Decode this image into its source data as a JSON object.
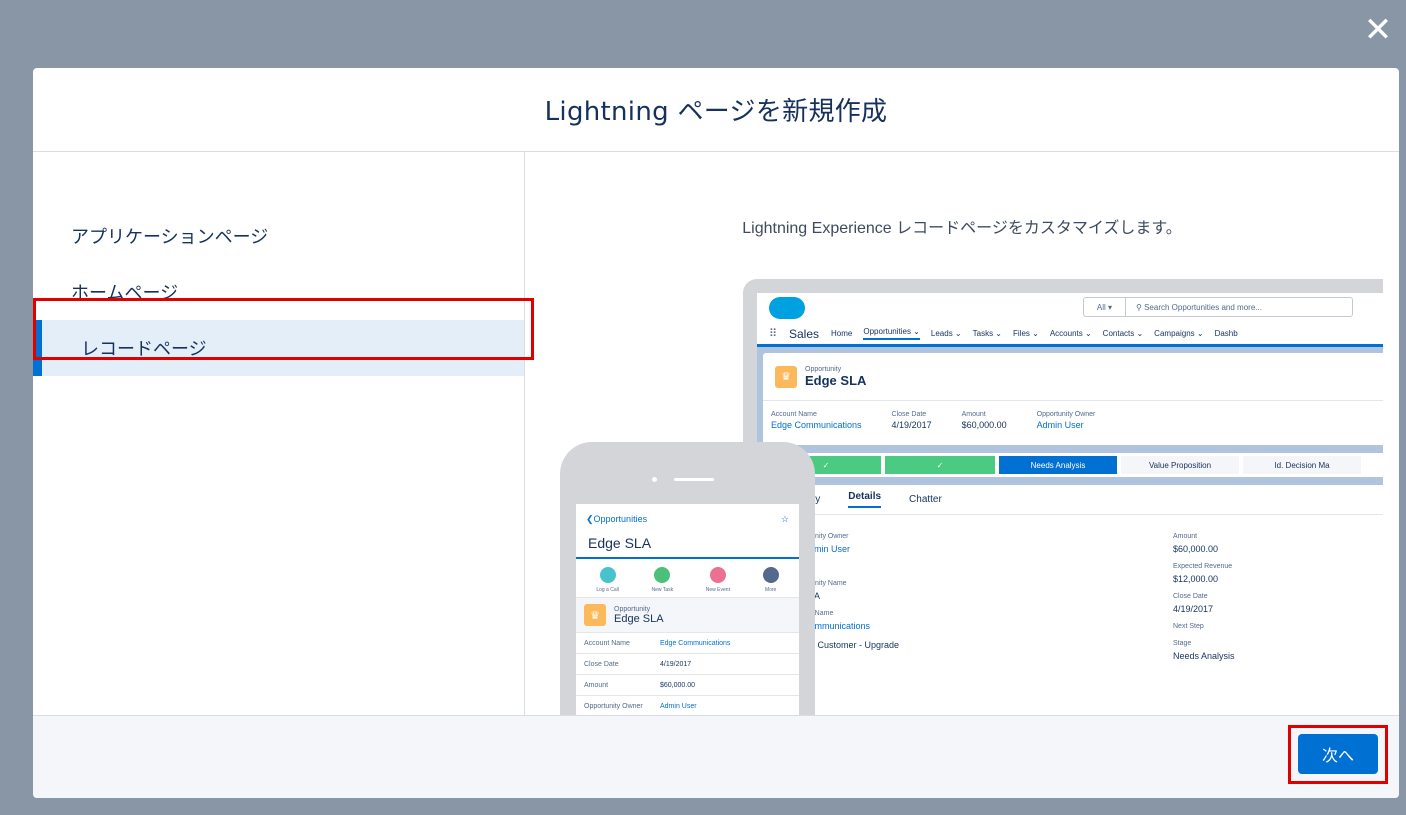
{
  "close_label": "✕",
  "modal": {
    "title": "Lightning ページを新規作成",
    "page_types": [
      {
        "label": "アプリケーションページ"
      },
      {
        "label": "ホームページ"
      },
      {
        "label": "レコードページ"
      }
    ],
    "description": "Lightning Experience レコードページをカスタマイズします。",
    "next_label": "次へ"
  },
  "desktop_preview": {
    "search_scope": "All ▾",
    "search_placeholder": "Search Opportunities and more...",
    "app_name": "Sales",
    "nav": [
      "Home",
      "Opportunities ⌄",
      "Leads ⌄",
      "Tasks ⌄",
      "Files ⌄",
      "Accounts ⌄",
      "Contacts ⌄",
      "Campaigns ⌄",
      "Dashb"
    ],
    "object_label": "Opportunity",
    "record_name": "Edge SLA",
    "fields": [
      {
        "label": "Account Name",
        "value": "Edge Communications"
      },
      {
        "label": "Close Date",
        "value": "4/19/2017"
      },
      {
        "label": "Amount",
        "value": "$60,000.00"
      },
      {
        "label": "Opportunity Owner",
        "value": "Admin User"
      }
    ],
    "path": [
      "✓",
      "✓",
      "Needs Analysis",
      "Value Proposition",
      "Id. Decision Ma"
    ],
    "tabs": [
      "ivity",
      "Details",
      "Chatter"
    ],
    "left_col": [
      {
        "label": "ortunity Owner",
        "value": "Admin User"
      },
      {
        "label": "e",
        "value": ""
      },
      {
        "label": "ortunity Name",
        "value": "SLA"
      },
      {
        "label": "unt Name",
        "value": "Communications"
      },
      {
        "label": "",
        "value": "ing Customer - Upgrade"
      }
    ],
    "right_col": [
      {
        "label": "Amount",
        "value": "$60,000.00"
      },
      {
        "label": "Expected Revenue",
        "value": "$12,000.00"
      },
      {
        "label": "Close Date",
        "value": "4/19/2017"
      },
      {
        "label": "Next Step",
        "value": ""
      },
      {
        "label": "Stage",
        "value": "Needs Analysis"
      }
    ]
  },
  "mobile_preview": {
    "back_label": "❮Opportunities",
    "star": "☆",
    "title": "Edge SLA",
    "actions": [
      {
        "label": "Log a Call",
        "color": "#48c3cc"
      },
      {
        "label": "New Task",
        "color": "#4bc076"
      },
      {
        "label": "New Event",
        "color": "#eb7092"
      },
      {
        "label": "More",
        "color": "#54698d"
      }
    ],
    "object_label": "Opportunity",
    "record_name": "Edge SLA",
    "rows": [
      {
        "key": "Account Name",
        "value": "Edge Communications"
      },
      {
        "key": "Close Date",
        "value": "4/19/2017"
      },
      {
        "key": "Amount",
        "value": "$60,000.00"
      },
      {
        "key": "Opportunity Owner",
        "value": "Admin User"
      }
    ]
  }
}
